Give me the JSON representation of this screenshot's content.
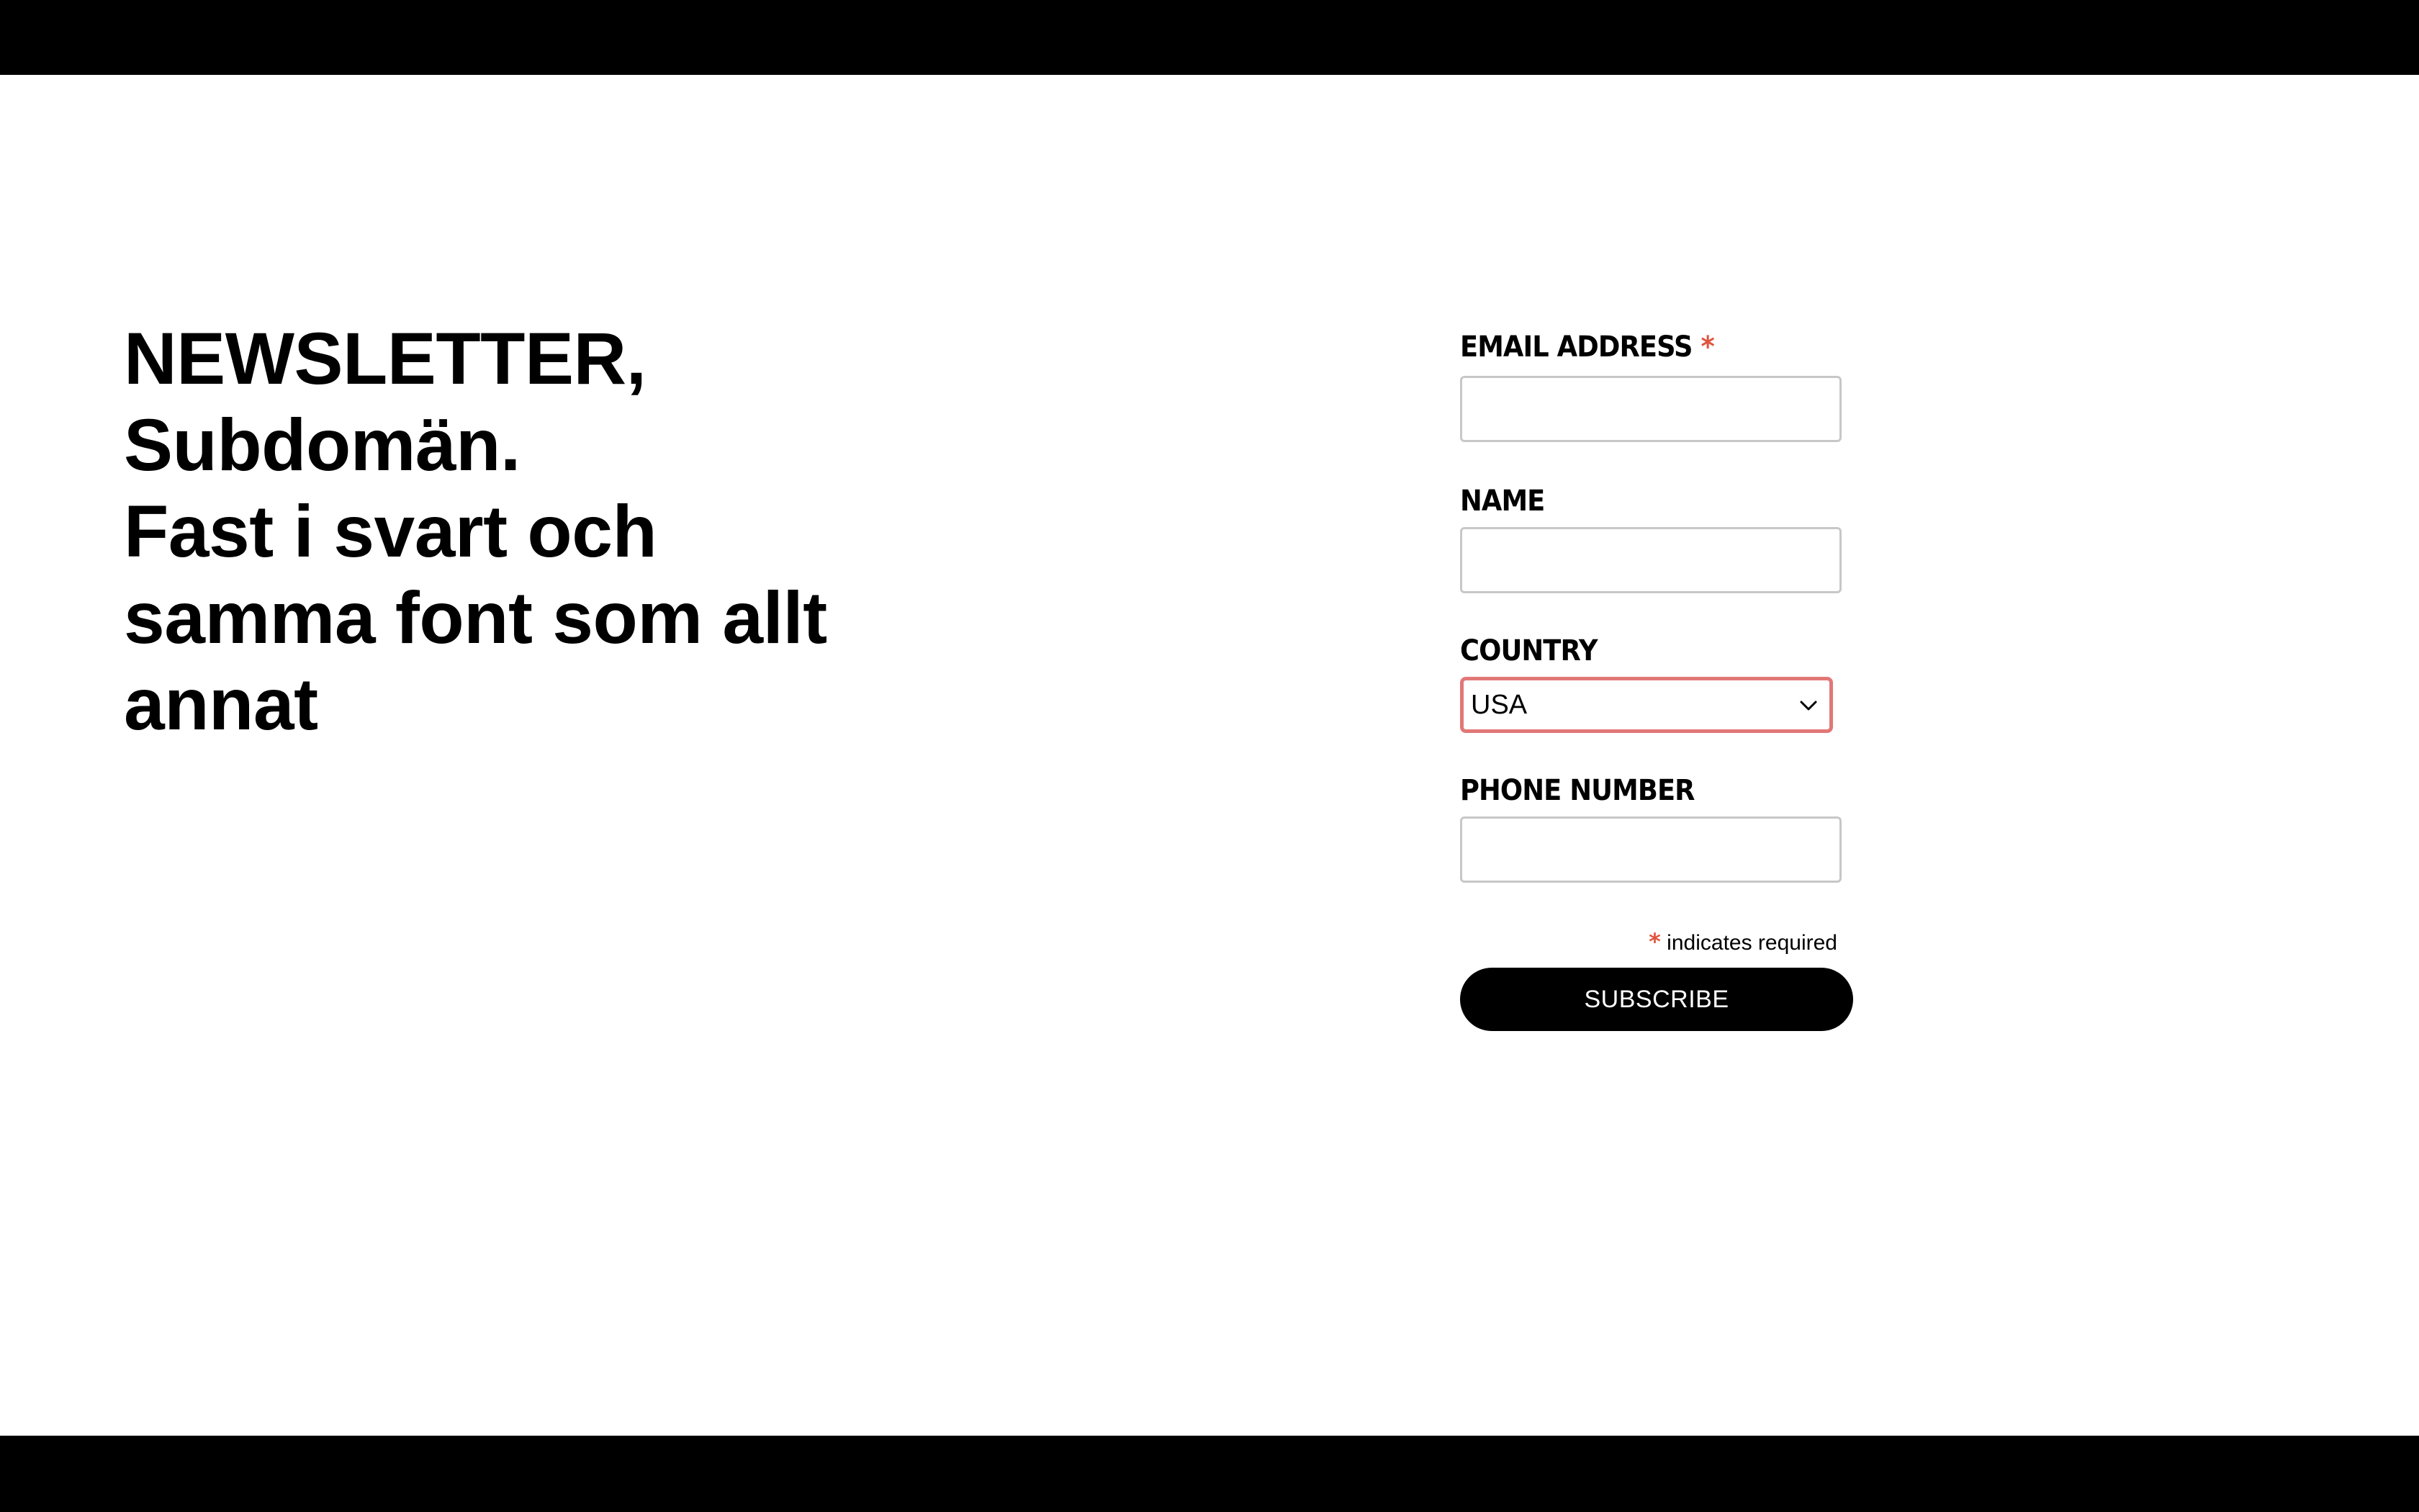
{
  "headline": {
    "lines": [
      "NEWSLETTER,",
      "Subdomän.",
      "Fast i svart och",
      "samma font som allt",
      "annat"
    ]
  },
  "form": {
    "email": {
      "label": "EMAIL ADDRESS",
      "required_mark": "*",
      "value": ""
    },
    "name": {
      "label": "NAME",
      "value": ""
    },
    "country": {
      "label": "COUNTRY",
      "selected": "USA"
    },
    "phone": {
      "label": "PHONE NUMBER",
      "value": ""
    },
    "required_note": {
      "mark": "*",
      "text": " indicates required"
    },
    "submit_label": "SUBSCRIBE"
  },
  "colors": {
    "accent_required": "#e0553f",
    "select_focus_border": "#e27777",
    "bars": "#000000"
  },
  "icons": {
    "select_chevron": "chevron-down-icon"
  }
}
